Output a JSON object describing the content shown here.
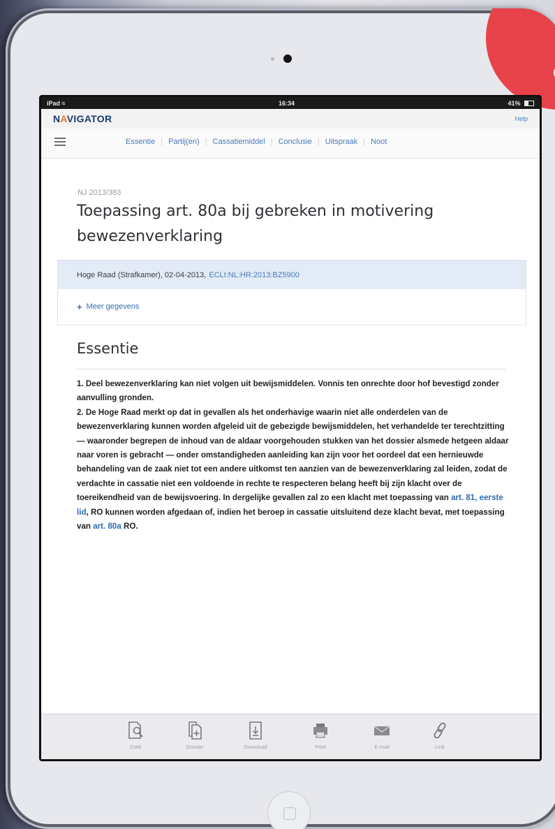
{
  "status": {
    "carrier": "iPad",
    "wifi_symbol": "≈",
    "time": "16:34",
    "battery": "41%"
  },
  "app": {
    "brand_n": "N",
    "brand_a": "A",
    "brand_rest": "VIGATOR",
    "help": "Help"
  },
  "tabs": [
    "Essentie",
    "Partij(en)",
    "Cassatiemiddel",
    "Conclusie",
    "Uitspraak",
    "Noot"
  ],
  "doc": {
    "nj": "NJ 2013/383",
    "title": "Toepassing art. 80a bij gebreken in motivering bewezenverklaring",
    "court": "Hoge Raad (Strafkamer), 02-04-2013,",
    "ecli": "ECLI:NL:HR:2013:BZ5900",
    "more_plus": "+",
    "more": "Meer gegevens",
    "section_title": "Essentie",
    "p1": "1. Deel bewezenverklaring kan niet volgen uit bewijsmiddelen. Vonnis ten onrechte door hof bevestigd zonder aanvulling gronden.",
    "p2_part1": "2. De Hoge Raad merkt op dat in gevallen als het onderhavige waarin niet alle onderdelen van de bewezenverklaring kunnen worden afgeleid uit de gebezigde bewijsmiddelen, het verhandelde ter terechtzitting — waaronder begrepen de inhoud van de aldaar voorgehouden stukken van het dossier alsmede hetgeen aldaar naar voren is gebracht — onder omstandigheden aanleiding kan zijn voor het oordeel dat een hernieuwde behandeling van de zaak niet tot een andere uitkomst ten aanzien van de bewezenverklaring zal leiden, zodat de verdachte in cassatie niet een voldoende in rechte te respecteren belang heeft bij zijn klacht over de toereikendheid van de bewijsvoering. In dergelijke gevallen zal zo een klacht met toepassing van ",
    "link1": "art. 81, eerste lid",
    "p2_part2": ", RO kunnen worden afgedaan of, indien het beroep in cassatie uitsluitend deze klacht bevat, met toepassing van ",
    "link2": "art. 80a",
    "p2_part3": " RO."
  },
  "toolbar": [
    {
      "label": "Zoek",
      "icon": "search-document-icon"
    },
    {
      "label": "Dossier",
      "icon": "add-to-dossier-icon"
    },
    {
      "label": "Download",
      "icon": "download-icon"
    },
    {
      "label": "Print",
      "icon": "printer-icon"
    },
    {
      "label": "E-mail",
      "icon": "mail-icon"
    },
    {
      "label": "Link",
      "icon": "link-icon"
    }
  ],
  "colors": {
    "accent": "#4a7ab8",
    "brand": "#1c3b6e",
    "brand_accent": "#e37a22",
    "red_blob": "#e8434b"
  }
}
